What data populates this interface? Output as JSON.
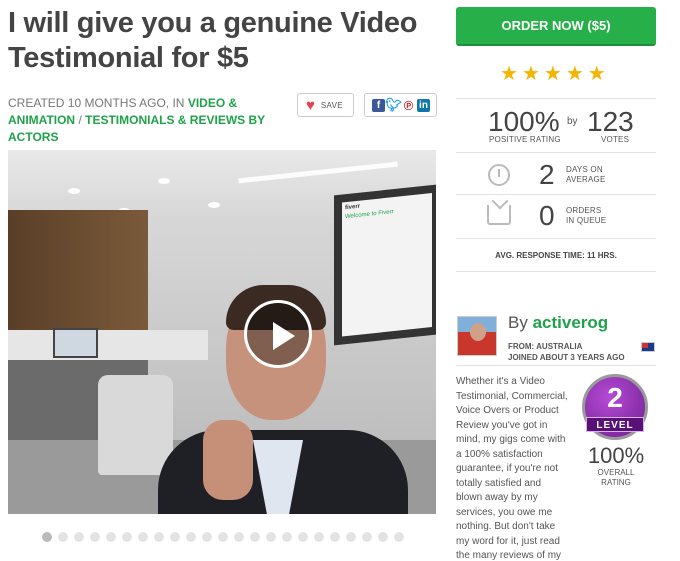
{
  "gig": {
    "title": "I will give you a genuine Video Testimonial for $5",
    "created_prefix": "CREATED 10 MONTHS AGO, IN",
    "category": "VIDEO & ANIMATION",
    "separator": "/",
    "subcategory": "TESTIMONIALS & REVIEWS BY ACTORS"
  },
  "actions": {
    "save_label": "SAVE",
    "share_icons": [
      "facebook-icon",
      "twitter-icon",
      "pinterest-icon",
      "linkedin-icon"
    ]
  },
  "video": {
    "screen_title": "fiverr",
    "screen_subtitle": "Welcome to Fiverr",
    "gallery_dots_count": 23,
    "active_dot_index": 0
  },
  "order": {
    "button_label": "ORDER NOW ($5)"
  },
  "rating": {
    "stars": 5,
    "positive_pct": "100%",
    "positive_label": "POSITIVE RATING",
    "by": "by",
    "votes": "123",
    "votes_label": "VOTES"
  },
  "delivery": {
    "days": "2",
    "days_label_1": "DAYS ON",
    "days_label_2": "AVERAGE"
  },
  "queue": {
    "orders": "0",
    "orders_label_1": "ORDERS",
    "orders_label_2": "IN QUEUE"
  },
  "response": {
    "text": "AVG. RESPONSE TIME: 11 HRS."
  },
  "seller": {
    "by_prefix": "By",
    "username": "activerog",
    "from": "FROM: AUSTRALIA",
    "joined": "JOINED ABOUT 3 YEARS AGO",
    "bio": "Whether it's a Video Testimonial, Commercial, Voice Overs or Product Review you've got in mind, my gigs come with a 100% satisfaction guarantee, if you're not totally satisfied and blown away by my services, you owe me nothing. But don't take my word for it, just read the many reviews of my gigs.",
    "level_number": "2",
    "level_label": "LEVEL",
    "overall_pct": "100%",
    "overall_label_1": "OVERALL",
    "overall_label_2": "RATING"
  },
  "colors": {
    "brand_green": "#27b04a",
    "link_green": "#1fa34a",
    "star_gold": "#f4b400",
    "level_purple": "#8a2fb0"
  }
}
